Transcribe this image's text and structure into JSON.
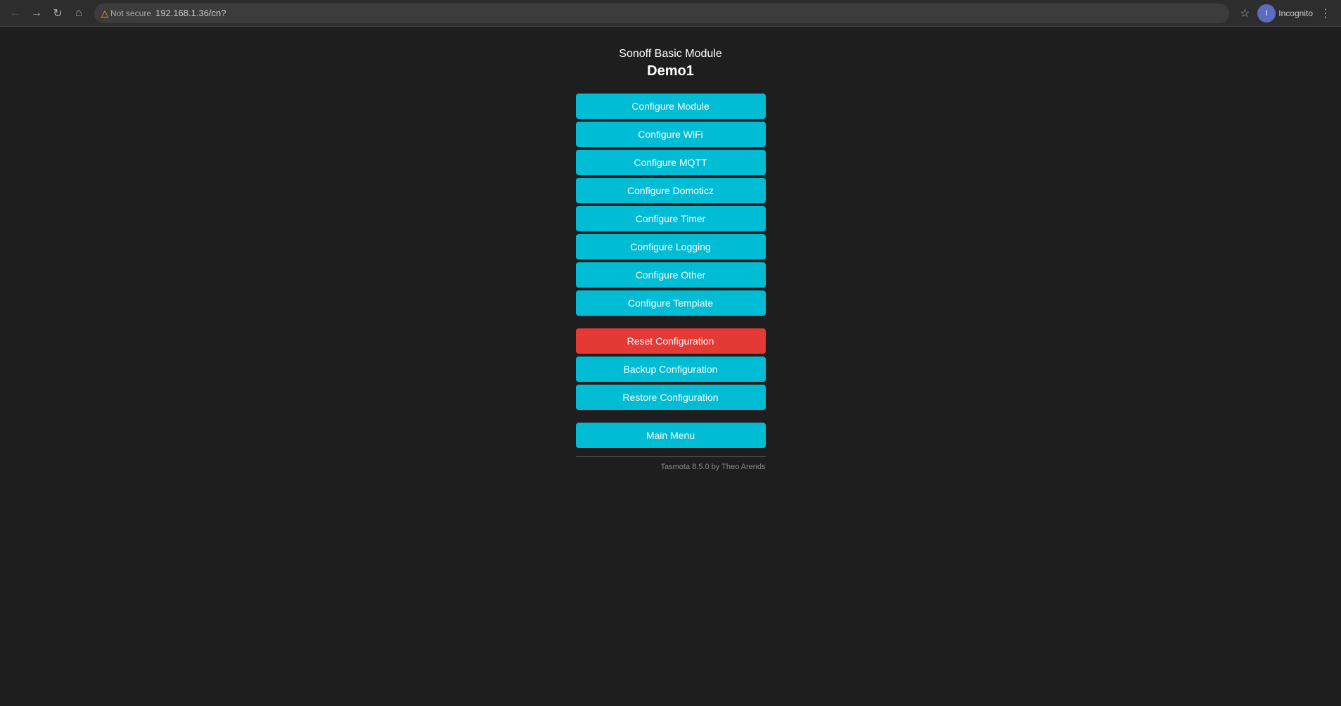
{
  "browser": {
    "url": "192.168.1.36/cn?",
    "not_secure_label": "Not secure",
    "incognito_label": "Incognito",
    "user_initial": "I"
  },
  "page": {
    "title": "Sonoff Basic Module",
    "device_name": "Demo1",
    "footer": "Tasmota 8.5.0 by Theo Arends"
  },
  "buttons": {
    "configure_module": "Configure Module",
    "configure_wifi": "Configure WiFi",
    "configure_mqtt": "Configure MQTT",
    "configure_domoticz": "Configure Domoticz",
    "configure_timer": "Configure Timer",
    "configure_logging": "Configure Logging",
    "configure_other": "Configure Other",
    "configure_template": "Configure Template",
    "reset_configuration": "Reset Configuration",
    "backup_configuration": "Backup Configuration",
    "restore_configuration": "Restore Configuration",
    "main_menu": "Main Menu"
  }
}
